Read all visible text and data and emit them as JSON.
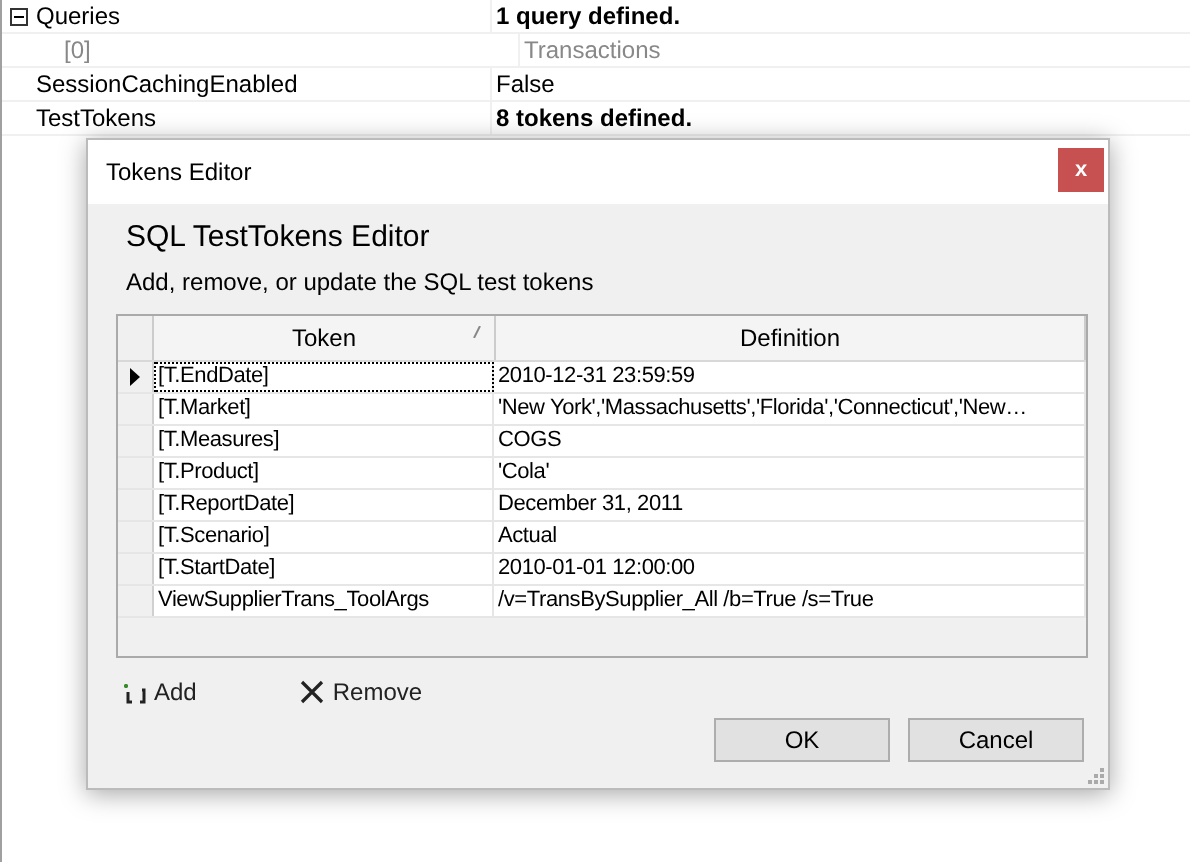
{
  "properties": [
    {
      "name": "Queries",
      "value": "1 query defined.",
      "kind": "group",
      "expanded": true
    },
    {
      "name": "[0]",
      "value": "Transactions",
      "kind": "child"
    },
    {
      "name": "SessionCachingEnabled",
      "value": "False",
      "kind": "plain"
    },
    {
      "name": "TestTokens",
      "value": "8 tokens defined.",
      "kind": "summary"
    }
  ],
  "dialog": {
    "title": "Tokens Editor",
    "close": "x",
    "heading": "SQL TestTokens Editor",
    "description": "Add, remove, or update the SQL test tokens",
    "columns": [
      "Token",
      "Definition"
    ],
    "rows": [
      {
        "token": "[T.EndDate]",
        "definition": "2010-12-31 23:59:59",
        "current": true
      },
      {
        "token": "[T.Market]",
        "definition": "'New  York','Massachusetts','Florida','Connecticut','New…",
        "current": false
      },
      {
        "token": "[T.Measures]",
        "definition": "COGS",
        "current": false
      },
      {
        "token": "[T.Product]",
        "definition": "'Cola'",
        "current": false
      },
      {
        "token": "[T.ReportDate]",
        "definition": "December 31, 2011",
        "current": false
      },
      {
        "token": "[T.Scenario]",
        "definition": "Actual",
        "current": false
      },
      {
        "token": "[T.StartDate]",
        "definition": "2010-01-01 12:00:00",
        "current": false
      },
      {
        "token": "ViewSupplierTrans_ToolArgs",
        "definition": "/v=TransBySupplier_All /b=True /s=True",
        "current": false
      }
    ],
    "actions": [
      {
        "label": "Add",
        "kind": "add"
      },
      {
        "label": "Remove",
        "kind": "remove"
      }
    ],
    "buttons": [
      "OK",
      "Cancel"
    ]
  }
}
